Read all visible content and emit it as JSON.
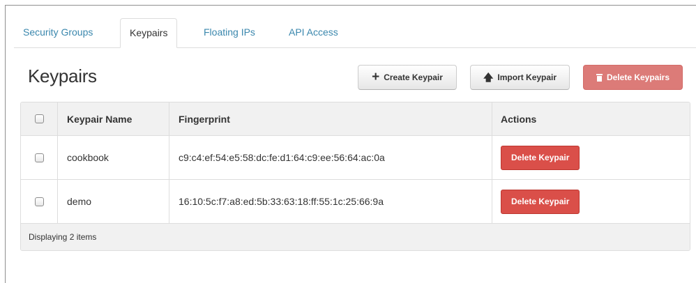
{
  "tabs": [
    {
      "label": "Security Groups",
      "active": false
    },
    {
      "label": "Keypairs",
      "active": true
    },
    {
      "label": "Floating IPs",
      "active": false
    },
    {
      "label": "API Access",
      "active": false
    }
  ],
  "page": {
    "title": "Keypairs"
  },
  "toolbar": {
    "create_label": "Create Keypair",
    "import_label": "Import Keypair",
    "delete_label": "Delete Keypairs"
  },
  "table": {
    "columns": [
      "Keypair Name",
      "Fingerprint",
      "Actions"
    ],
    "rows": [
      {
        "name": "cookbook",
        "fingerprint": "c9:c4:ef:54:e5:58:dc:fe:d1:64:c9:ee:56:64:ac:0a",
        "action_label": "Delete Keypair"
      },
      {
        "name": "demo",
        "fingerprint": "16:10:5c:f7:a8:ed:5b:33:63:18:ff:55:1c:25:66:9a",
        "action_label": "Delete Keypair"
      }
    ],
    "footer": "Displaying 2 items"
  },
  "icons": {
    "create": "plus-icon",
    "import": "upload-arrow-icon",
    "delete": "trash-icon"
  },
  "colors": {
    "link": "#3a87ad",
    "danger": "#da4f49",
    "danger_disabled": "#dc7b78"
  }
}
